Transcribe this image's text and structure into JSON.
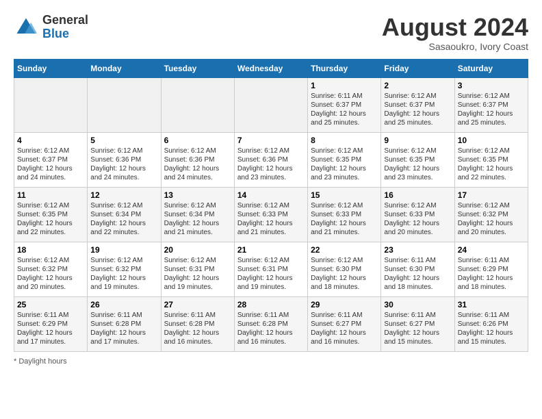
{
  "header": {
    "logo_general": "General",
    "logo_blue": "Blue",
    "month_year": "August 2024",
    "location": "Sasaoukro, Ivory Coast"
  },
  "footer": {
    "label": "Daylight hours"
  },
  "days_of_week": [
    "Sunday",
    "Monday",
    "Tuesday",
    "Wednesday",
    "Thursday",
    "Friday",
    "Saturday"
  ],
  "weeks": [
    [
      {
        "day": "",
        "info": ""
      },
      {
        "day": "",
        "info": ""
      },
      {
        "day": "",
        "info": ""
      },
      {
        "day": "",
        "info": ""
      },
      {
        "day": "1",
        "info": "Sunrise: 6:11 AM\nSunset: 6:37 PM\nDaylight: 12 hours\nand 25 minutes."
      },
      {
        "day": "2",
        "info": "Sunrise: 6:12 AM\nSunset: 6:37 PM\nDaylight: 12 hours\nand 25 minutes."
      },
      {
        "day": "3",
        "info": "Sunrise: 6:12 AM\nSunset: 6:37 PM\nDaylight: 12 hours\nand 25 minutes."
      }
    ],
    [
      {
        "day": "4",
        "info": "Sunrise: 6:12 AM\nSunset: 6:37 PM\nDaylight: 12 hours\nand 24 minutes."
      },
      {
        "day": "5",
        "info": "Sunrise: 6:12 AM\nSunset: 6:36 PM\nDaylight: 12 hours\nand 24 minutes."
      },
      {
        "day": "6",
        "info": "Sunrise: 6:12 AM\nSunset: 6:36 PM\nDaylight: 12 hours\nand 24 minutes."
      },
      {
        "day": "7",
        "info": "Sunrise: 6:12 AM\nSunset: 6:36 PM\nDaylight: 12 hours\nand 23 minutes."
      },
      {
        "day": "8",
        "info": "Sunrise: 6:12 AM\nSunset: 6:35 PM\nDaylight: 12 hours\nand 23 minutes."
      },
      {
        "day": "9",
        "info": "Sunrise: 6:12 AM\nSunset: 6:35 PM\nDaylight: 12 hours\nand 23 minutes."
      },
      {
        "day": "10",
        "info": "Sunrise: 6:12 AM\nSunset: 6:35 PM\nDaylight: 12 hours\nand 22 minutes."
      }
    ],
    [
      {
        "day": "11",
        "info": "Sunrise: 6:12 AM\nSunset: 6:35 PM\nDaylight: 12 hours\nand 22 minutes."
      },
      {
        "day": "12",
        "info": "Sunrise: 6:12 AM\nSunset: 6:34 PM\nDaylight: 12 hours\nand 22 minutes."
      },
      {
        "day": "13",
        "info": "Sunrise: 6:12 AM\nSunset: 6:34 PM\nDaylight: 12 hours\nand 21 minutes."
      },
      {
        "day": "14",
        "info": "Sunrise: 6:12 AM\nSunset: 6:33 PM\nDaylight: 12 hours\nand 21 minutes."
      },
      {
        "day": "15",
        "info": "Sunrise: 6:12 AM\nSunset: 6:33 PM\nDaylight: 12 hours\nand 21 minutes."
      },
      {
        "day": "16",
        "info": "Sunrise: 6:12 AM\nSunset: 6:33 PM\nDaylight: 12 hours\nand 20 minutes."
      },
      {
        "day": "17",
        "info": "Sunrise: 6:12 AM\nSunset: 6:32 PM\nDaylight: 12 hours\nand 20 minutes."
      }
    ],
    [
      {
        "day": "18",
        "info": "Sunrise: 6:12 AM\nSunset: 6:32 PM\nDaylight: 12 hours\nand 20 minutes."
      },
      {
        "day": "19",
        "info": "Sunrise: 6:12 AM\nSunset: 6:32 PM\nDaylight: 12 hours\nand 19 minutes."
      },
      {
        "day": "20",
        "info": "Sunrise: 6:12 AM\nSunset: 6:31 PM\nDaylight: 12 hours\nand 19 minutes."
      },
      {
        "day": "21",
        "info": "Sunrise: 6:12 AM\nSunset: 6:31 PM\nDaylight: 12 hours\nand 19 minutes."
      },
      {
        "day": "22",
        "info": "Sunrise: 6:12 AM\nSunset: 6:30 PM\nDaylight: 12 hours\nand 18 minutes."
      },
      {
        "day": "23",
        "info": "Sunrise: 6:11 AM\nSunset: 6:30 PM\nDaylight: 12 hours\nand 18 minutes."
      },
      {
        "day": "24",
        "info": "Sunrise: 6:11 AM\nSunset: 6:29 PM\nDaylight: 12 hours\nand 18 minutes."
      }
    ],
    [
      {
        "day": "25",
        "info": "Sunrise: 6:11 AM\nSunset: 6:29 PM\nDaylight: 12 hours\nand 17 minutes."
      },
      {
        "day": "26",
        "info": "Sunrise: 6:11 AM\nSunset: 6:28 PM\nDaylight: 12 hours\nand 17 minutes."
      },
      {
        "day": "27",
        "info": "Sunrise: 6:11 AM\nSunset: 6:28 PM\nDaylight: 12 hours\nand 16 minutes."
      },
      {
        "day": "28",
        "info": "Sunrise: 6:11 AM\nSunset: 6:28 PM\nDaylight: 12 hours\nand 16 minutes."
      },
      {
        "day": "29",
        "info": "Sunrise: 6:11 AM\nSunset: 6:27 PM\nDaylight: 12 hours\nand 16 minutes."
      },
      {
        "day": "30",
        "info": "Sunrise: 6:11 AM\nSunset: 6:27 PM\nDaylight: 12 hours\nand 15 minutes."
      },
      {
        "day": "31",
        "info": "Sunrise: 6:11 AM\nSunset: 6:26 PM\nDaylight: 12 hours\nand 15 minutes."
      }
    ]
  ]
}
